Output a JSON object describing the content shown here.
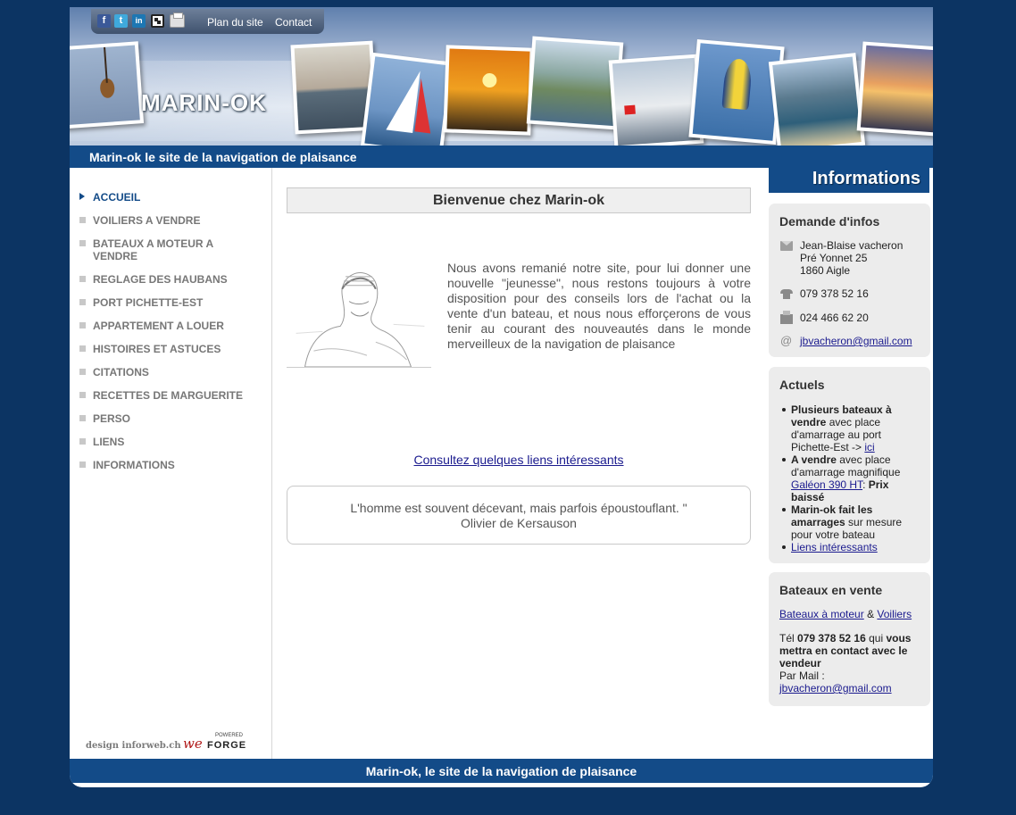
{
  "header": {
    "social_icons": [
      "facebook-icon",
      "twitter-icon",
      "linkedin-icon",
      "qr-code-icon",
      "print-icon"
    ],
    "plan_label": "Plan du site",
    "contact_label": "Contact",
    "logo": "MARIN-OK",
    "slogan": "Marin-ok le site de la navigation de plaisance",
    "accent_color": "#134b88"
  },
  "nav": {
    "items": [
      {
        "label": "ACCUEIL",
        "active": true
      },
      {
        "label": "VOILIERS A VENDRE"
      },
      {
        "label": "BATEAUX A MOTEUR A VENDRE"
      },
      {
        "label": "REGLAGE DES HAUBANS"
      },
      {
        "label": "PORT PICHETTE-EST"
      },
      {
        "label": "APPARTEMENT A LOUER"
      },
      {
        "label": "HISTOIRES ET ASTUCES"
      },
      {
        "label": "CITATIONS"
      },
      {
        "label": "RECETTES DE MARGUERITE"
      },
      {
        "label": "PERSO"
      },
      {
        "label": "LIENS"
      },
      {
        "label": "INFORMATIONS"
      }
    ],
    "credit_design": "design inforweb.ch",
    "webforge_we": "we",
    "webforge_forge": "FORGE",
    "webforge_powered": "POWERED"
  },
  "main": {
    "welcome": "Bienvenue chez Marin-ok",
    "intro": "Nous avons remanié notre site, pour lui donner une nouvelle \"jeunesse\", nous restons toujours à votre disposition pour des conseils lors de l'achat ou la vente d'un bateau, et nous nous efforçerons de vous tenir au courant des nouveautés dans le monde merveilleux de la navigation de plaisance",
    "links_cta": "Consultez quelques liens intéressants",
    "quote": "L'homme est souvent décevant, mais parfois époustouflant. \"",
    "quote_author": "Olivier de Kersauson"
  },
  "sidebar": {
    "tab_label": "Informations",
    "demande": {
      "title": "Demande d'infos",
      "name": "Jean-Blaise vacheron",
      "street": "Pré Yonnet 25",
      "city": "1860 Aigle",
      "phone": "079 378 52 16",
      "fax": "024 466 62 20",
      "email": "jbvacheron@gmail.com"
    },
    "actuels": {
      "title": "Actuels",
      "item1_bold": "Plusieurs bateaux à vendre",
      "item1_text": " avec place d'amarrage au port Pichette-Est -> ",
      "item1_link": "ici",
      "item2_bold": "A vendre",
      "item2_text": " avec place d'amarrage magnifique ",
      "item2_link": "Galéon 390 HT",
      "item2_sep": ": ",
      "item2_bold2": "Prix baissé",
      "item3_bold": "Marin-ok fait les amarrages",
      "item3_text": " sur mesure pour votre bateau",
      "item4_link": "Liens intéressants"
    },
    "bateaux": {
      "title": "Bateaux en vente",
      "link_moteur": "Bateaux à moteur",
      "amp": " & ",
      "link_voiliers": "Voiliers",
      "tel_prefix": "Tél ",
      "tel_number": "079 378 52 16",
      "tel_middle": " qui ",
      "tel_bold": "vous mettra en contact avec le vendeur",
      "mail_label": "Par Mail :",
      "email": "jbvacheron@gmail.com"
    }
  },
  "footer": {
    "text": "Marin-ok, le site de la navigation de plaisance"
  }
}
